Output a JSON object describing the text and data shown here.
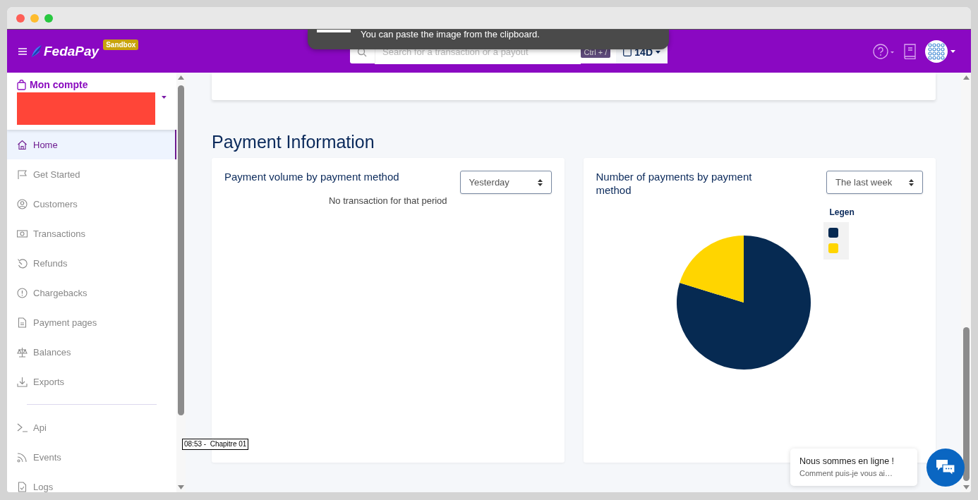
{
  "toast": {
    "text": "You can paste the image from the clipboard."
  },
  "header": {
    "brand": "FedaPay",
    "badge": "Sandbox",
    "search": {
      "placeholder": "Search for a transaction or a payout",
      "shortcut": "Ctrl + /"
    },
    "period": "14D"
  },
  "sidebar": {
    "account": {
      "title": "Mon compte"
    },
    "groups": [
      {
        "items": [
          {
            "label": "Home",
            "selected": true
          },
          {
            "label": "Get Started",
            "selected": false
          },
          {
            "label": "Customers",
            "selected": false
          },
          {
            "label": "Transactions",
            "selected": false
          },
          {
            "label": "Refunds",
            "selected": false
          },
          {
            "label": "Chargebacks",
            "selected": false
          },
          {
            "label": "Payment pages",
            "selected": false
          },
          {
            "label": "Balances",
            "selected": false
          },
          {
            "label": "Exports",
            "selected": false
          }
        ]
      },
      {
        "items": [
          {
            "label": "Api",
            "selected": false
          },
          {
            "label": "Events",
            "selected": false
          },
          {
            "label": "Logs",
            "selected": false
          }
        ]
      }
    ]
  },
  "main": {
    "heading": "Payment Information",
    "cards": [
      {
        "kind": "empty",
        "title": "Payment volume by payment method",
        "select": "Yesterday",
        "message": "No transaction for that period"
      },
      {
        "kind": "pie",
        "title": "Number of payments by payment method",
        "select": "The last week",
        "legend": {
          "title": "Legen",
          "items": [
            {
              "color": "#062a52"
            },
            {
              "color": "#ffd500"
            }
          ]
        }
      }
    ]
  },
  "tooltip": {
    "text": "08:53 -  Chapitre 01"
  },
  "chat": {
    "title": "Nous sommes en ligne !",
    "subtitle": "Comment puis-je vous ai…"
  }
}
